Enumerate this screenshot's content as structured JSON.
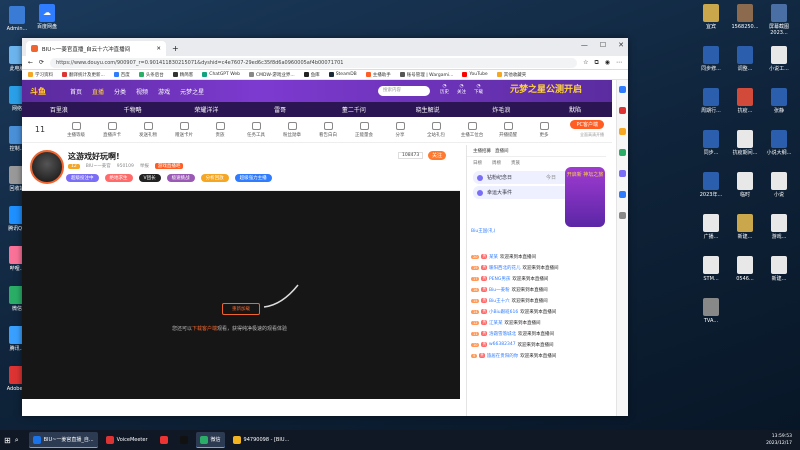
{
  "desktop": {
    "left_icons": [
      "Admin...",
      "此电脑",
      "网络",
      "控制...",
      "回收站",
      "腾讯QQ",
      "哔哩...",
      "微信",
      "腾讯...",
      "Adobe..."
    ],
    "top_icons": [
      "百度网盘"
    ],
    "right_icons": [
      {
        "label": "宜宾",
        "color": "#c9a74a"
      },
      {
        "label": "1568250...",
        "color": "#8b6a4e"
      },
      {
        "label": "屏幕截图 2023...",
        "color": "#4a6fa5"
      },
      {
        "label": "同步修...",
        "color": "#2b5fad"
      },
      {
        "label": "调整...",
        "color": "#2b5fad"
      },
      {
        "label": "小说工...",
        "color": "#e8e8e8"
      },
      {
        "label": "周期行...",
        "color": "#2b5fad"
      },
      {
        "label": "抗疫...",
        "color": "#d14a3a"
      },
      {
        "label": "张静",
        "color": "#2b5fad"
      },
      {
        "label": "同步...",
        "color": "#2b5fad"
      },
      {
        "label": "抗疫期间...",
        "color": "#e8e8e8"
      },
      {
        "label": "小说大纲...",
        "color": "#2b5fad"
      },
      {
        "label": "2023年...",
        "color": "#2b5fad"
      },
      {
        "label": "临时",
        "color": "#e8e8e8"
      },
      {
        "label": "小说",
        "color": "#e8e8e8"
      },
      {
        "label": "广播...",
        "color": "#e8e8e8"
      },
      {
        "label": "新建...",
        "color": "#c9a74a"
      },
      {
        "label": "游戏...",
        "color": "#e8e8e8"
      },
      {
        "label": "STM...",
        "color": "#e8e8e8"
      },
      {
        "label": "0546...",
        "color": "#e8e8e8"
      },
      {
        "label": "新建...",
        "color": "#e8e8e8"
      },
      {
        "label": "TVA...",
        "color": "#888"
      }
    ]
  },
  "browser": {
    "tab_title": "BIU~一姜官直播_自云十六冲直播间",
    "url": "https://www.douyu.com/900907_r=0.901411830215071&dyshid=c4e7607-29ed6c35f8d6a0960005af4b00071701",
    "bookmarks": [
      "学习资料",
      "翻译统计及更新...",
      "百度",
      "头条后台",
      "精简客",
      "ChatGPT Web",
      "CMDW-游戏业界...",
      "鱼库",
      "SteamDB",
      "主播助手",
      "账号管理 | Wargami...",
      "YouTube",
      "其他收藏夹"
    ]
  },
  "site": {
    "nav_items": [
      "首页",
      "直播",
      "分类",
      "视频",
      "游戏",
      "元梦之星"
    ],
    "logo": "斗鱼",
    "banner_text": "元梦之星公测开启",
    "search_placeholder": "搜索内容",
    "nav_icons": [
      "历史",
      "关注",
      "下载"
    ],
    "categories": [
      "百里浪",
      "千物略",
      "荣耀洋洋",
      "雷哥",
      "董二千问",
      "晓生解说",
      "炸毛浪",
      "默陷"
    ],
    "tools_num": "11",
    "tools": [
      "主播等级",
      "直播声卡",
      "发送礼物",
      "赠送卡片",
      "贵族",
      "任务工具",
      "粉丝勋章",
      "看告白白",
      "正能量会",
      "分享",
      "全站礼包",
      "主播工位台",
      "开播提醒",
      "更多"
    ],
    "pc_button": "PC客户端",
    "pc_sub": "全面高清开播",
    "stream_title": "这游戏好玩啊!",
    "streamer": "BIU~一姜官",
    "report": "举报",
    "room_id": "950109",
    "tag_text": "游戏直播吧",
    "level": "12",
    "follow_count": "108473",
    "follow": "关注",
    "tags": [
      "超级投注中",
      "绝地求生",
      "V团长",
      "极速挑战",
      "分析回放",
      "超级强力主播"
    ],
    "reload": "重新加载",
    "tip_prefix": "您还可以",
    "tip_link": "下载客户端",
    "tip_suffix": "观看，获得纯净极速的观看体验"
  },
  "chat": {
    "tabs": [
      "主播招募",
      "直播间"
    ],
    "rank_tabs": [
      "日榜",
      "周榜",
      "贵族"
    ],
    "event1": "钻粉纪念日",
    "event2": "幸运大事件",
    "event_time": "今日",
    "promo_text": "开启新 神坛之旅",
    "system_msg": "Biu王国(礼)",
    "messages": [
      {
        "lv": "20",
        "user": "某某",
        "text": "欢迎来到本直播间"
      },
      {
        "lv": "19",
        "user": "暖阳西北的花儿",
        "text": "欢迎来到本直播间"
      },
      {
        "lv": "17",
        "user": "PENG男孩",
        "text": "欢迎来到本直播间"
      },
      {
        "lv": "16",
        "user": "Biu一姜粉",
        "text": "欢迎来到本直播间"
      },
      {
        "lv": "15",
        "user": "Biu王十六",
        "text": "欢迎来到本直播间"
      },
      {
        "lv": "14",
        "user": "小Biu跟班616",
        "text": "欢迎来到本直播间"
      },
      {
        "lv": "12",
        "user": "江某某",
        "text": "欢迎来到本直播间"
      },
      {
        "lv": "11",
        "user": "洛霜雪落城北",
        "text": "欢迎来到本直播间"
      },
      {
        "lv": "10",
        "user": "w66382347",
        "text": "欢迎来到本直播间"
      },
      {
        "lv": "9",
        "user": "旅居在贵阳的你",
        "text": "欢迎来到本直播间"
      }
    ]
  },
  "taskbar": {
    "items": [
      {
        "label": "BIU~一姜官直播_自...",
        "color": "#1a73e8",
        "active": true
      },
      {
        "label": "VoiceMeeter",
        "color": "#d33"
      },
      {
        "label": "",
        "color": "#e33"
      },
      {
        "label": "",
        "color": "#111"
      },
      {
        "label": "微信",
        "color": "#2aae67",
        "active": true
      },
      {
        "label": "94790098 - [BIU...",
        "color": "#f2b320"
      }
    ],
    "time": "13:59:53",
    "date": "2023/12/17"
  }
}
